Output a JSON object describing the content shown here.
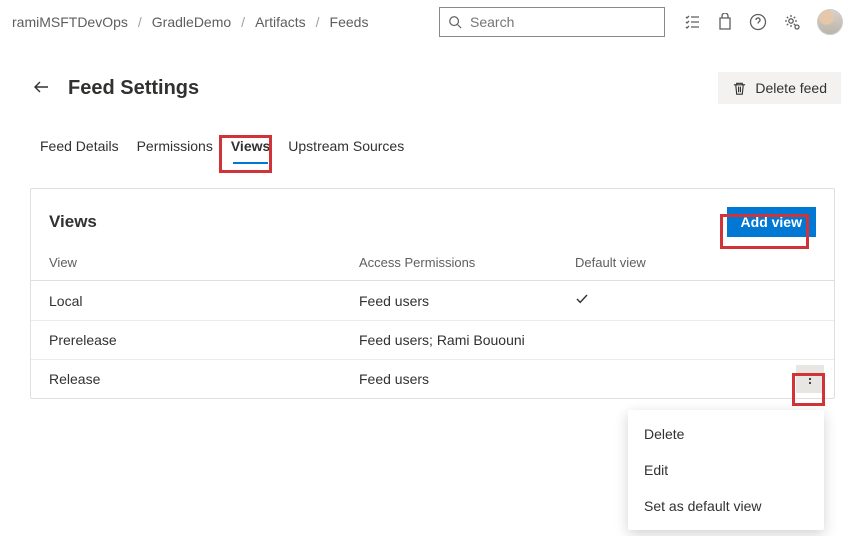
{
  "breadcrumb": {
    "org": "ramiMSFTDevOps",
    "project": "GradleDemo",
    "section": "Artifacts",
    "page": "Feeds"
  },
  "search": {
    "placeholder": "Search"
  },
  "header": {
    "title": "Feed Settings",
    "delete_label": "Delete feed"
  },
  "tabs": {
    "details": "Feed Details",
    "permissions": "Permissions",
    "views": "Views",
    "upstream": "Upstream Sources"
  },
  "panel": {
    "title": "Views",
    "add_button": "Add view",
    "columns": {
      "view": "View",
      "access": "Access Permissions",
      "default": "Default view"
    },
    "rows": [
      {
        "view": "Local",
        "access": "Feed users",
        "default": true
      },
      {
        "view": "Prerelease",
        "access": "Feed users; Rami Bououni",
        "default": false
      },
      {
        "view": "Release",
        "access": "Feed users",
        "default": false
      }
    ]
  },
  "menu": {
    "delete": "Delete",
    "edit": "Edit",
    "set_default": "Set as default view"
  }
}
